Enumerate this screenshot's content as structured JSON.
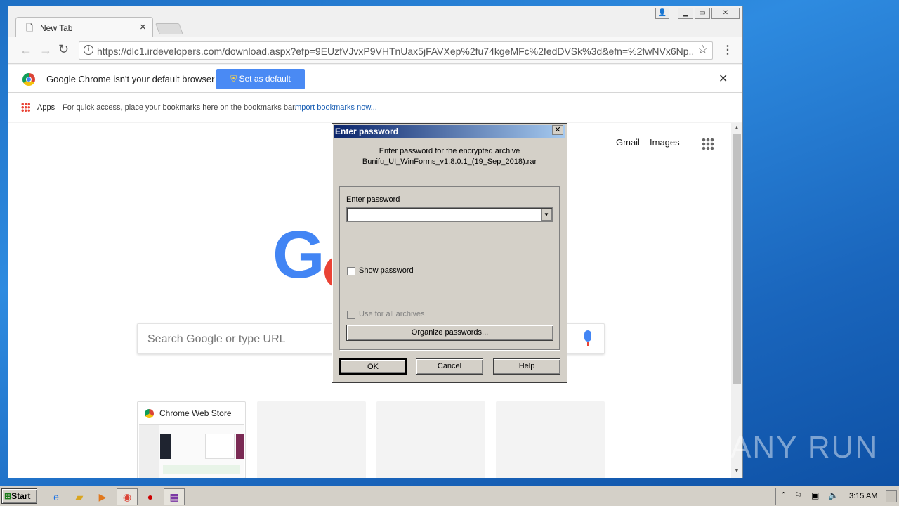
{
  "browser": {
    "tab_title": "New Tab",
    "tab_close": "×",
    "url": "https://dlc1.irdevelopers.com/download.aspx?efp=9EUzfVJvxP9VHTnUax5jFAVXep%2fu74kgeMFc%2fedDVSk%3d&efn=%2fwNVx6Np...",
    "infobar_text": "Google Chrome isn't your default browser",
    "set_default_label": "Set as default",
    "infobar_close": "✕",
    "apps_label": "Apps",
    "bookmarks_text": "For quick access, place your bookmarks here on the bookmarks bar.",
    "import_link": "Import bookmarks now...",
    "gmail": "Gmail",
    "images": "Images",
    "search_placeholder": "Search Google or type URL",
    "tile_label": "Chrome Web Store",
    "logo_g": "G"
  },
  "dialog": {
    "title": "Enter password",
    "close": "✕",
    "message_line1": "Enter password for the encrypted archive",
    "message_line2": "Bunifu_UI_WinForms_v1.8.0.1_(19_Sep_2018).rar",
    "password_label": "Enter password",
    "password_value": "",
    "show_password": "Show password",
    "use_for_all": "Use for all archives",
    "organize": "Organize passwords...",
    "ok": "OK",
    "cancel": "Cancel",
    "help": "Help"
  },
  "taskbar": {
    "start": "Start",
    "clock": "3:15 AM"
  },
  "watermark": "ANY RUN"
}
